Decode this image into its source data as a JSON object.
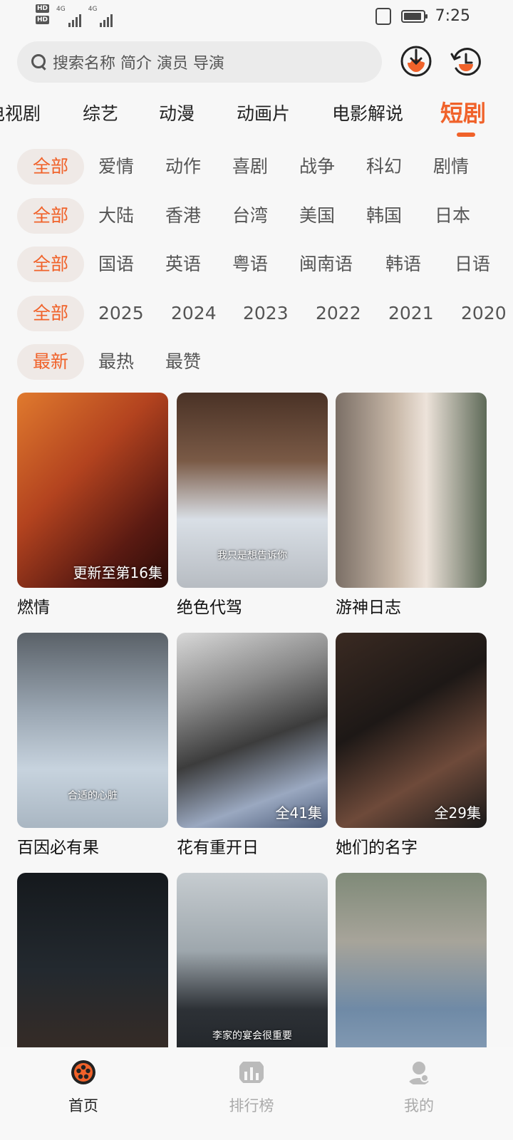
{
  "status_bar": {
    "hd1": "HD",
    "hd2": "HD",
    "net1": "4G",
    "net2": "4G",
    "time": "7:25"
  },
  "search": {
    "placeholder": "搜索名称 简介 演员 导演"
  },
  "tabs": [
    {
      "label": "电视剧",
      "active": false
    },
    {
      "label": "综艺",
      "active": false
    },
    {
      "label": "动漫",
      "active": false
    },
    {
      "label": "动画片",
      "active": false
    },
    {
      "label": "电影解说",
      "active": false
    },
    {
      "label": "短剧",
      "active": true
    }
  ],
  "filters": {
    "genre": [
      "全部",
      "爱情",
      "动作",
      "喜剧",
      "战争",
      "科幻",
      "剧情"
    ],
    "region": [
      "全部",
      "大陆",
      "香港",
      "台湾",
      "美国",
      "韩国",
      "日本"
    ],
    "language": [
      "全部",
      "国语",
      "英语",
      "粤语",
      "闽南语",
      "韩语",
      "日语"
    ],
    "year": [
      "全部",
      "2025",
      "2024",
      "2023",
      "2022",
      "2021",
      "2020"
    ],
    "sort": [
      "最新",
      "最热",
      "最赞"
    ]
  },
  "items": [
    {
      "title": "燃情",
      "badge": "更新至第16集",
      "subtitle": ""
    },
    {
      "title": "绝色代驾",
      "badge": "",
      "subtitle": "我只是想告诉你"
    },
    {
      "title": "游神日志",
      "badge": "",
      "subtitle": ""
    },
    {
      "title": "百因必有果",
      "badge": "",
      "subtitle": "合适的心脏"
    },
    {
      "title": "花有重开日",
      "badge": "全41集",
      "subtitle": ""
    },
    {
      "title": "她们的名字",
      "badge": "全29集",
      "subtitle": ""
    },
    {
      "title": "",
      "badge": "",
      "subtitle": ""
    },
    {
      "title": "",
      "badge": "",
      "subtitle": "李家的宴会很重要"
    },
    {
      "title": "",
      "badge": "",
      "subtitle": ""
    }
  ],
  "bottom_nav": [
    {
      "label": "首页",
      "active": true
    },
    {
      "label": "排行榜",
      "active": false
    },
    {
      "label": "我的",
      "active": false
    }
  ],
  "colors": {
    "accent": "#f0622a",
    "chip_bg": "#efe9e6",
    "inactive_nav": "#aaaaaa"
  }
}
